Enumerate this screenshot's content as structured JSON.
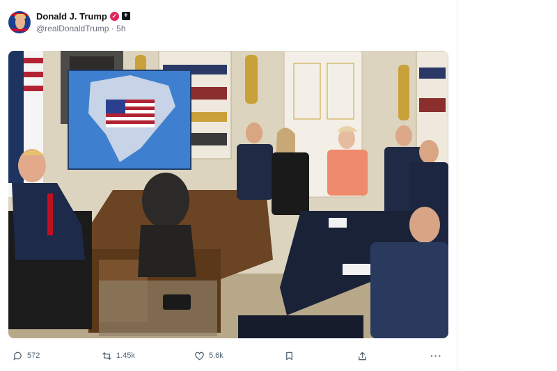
{
  "post": {
    "display_name": "Donald J. Trump",
    "handle": "@realDonaldTrump",
    "separator": "·",
    "time": "5h"
  },
  "icons": {
    "verified": "verified-badge-icon",
    "affiliate": "affiliate-badge-icon",
    "reply": "reply-icon",
    "repost": "repost-icon",
    "like": "heart-icon",
    "bookmark": "bookmark-icon",
    "share": "share-icon",
    "more": "more-icon"
  },
  "actions": {
    "replies": "572",
    "reposts": "1.45k",
    "likes": "5.6k",
    "more_label": "···"
  },
  "colors": {
    "verified": "#e0245e",
    "text": "#0f1419",
    "muted": "#536471"
  }
}
